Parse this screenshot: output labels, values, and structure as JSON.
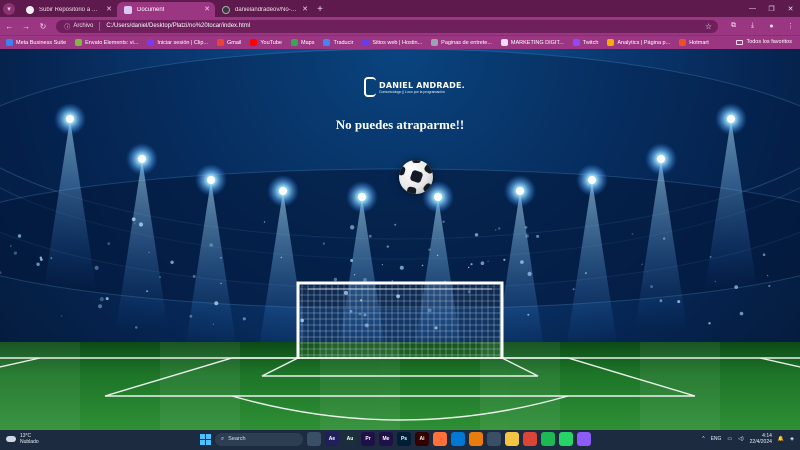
{
  "browser": {
    "tabs": [
      {
        "title": "Subir Repositorio a GitHub",
        "favicon": "github-icon",
        "active": false
      },
      {
        "title": "Document",
        "favicon": "document-icon",
        "active": true
      },
      {
        "title": "danielandradeov/No-me-pued...",
        "favicon": "github-icon",
        "active": false
      }
    ],
    "address": {
      "site_label": "Archivo",
      "url": "C:/Users/daniel/Desktop/Platzi/no%20tocar/index.html"
    },
    "bookmarks": [
      {
        "label": "Meta Business Suite",
        "color": "#3b82f6"
      },
      {
        "label": "Envato Elements: vi...",
        "color": "#82b541"
      },
      {
        "label": "Iniciar sesión | Clip...",
        "color": "#7c3aed"
      },
      {
        "label": "Gmail",
        "color": "#ea4335"
      },
      {
        "label": "YouTube",
        "color": "#ff0000"
      },
      {
        "label": "Maps",
        "color": "#34a853"
      },
      {
        "label": "Traducir",
        "color": "#4285f4"
      },
      {
        "label": "Sitios web | Hostin...",
        "color": "#673de6"
      },
      {
        "label": "Paginas de entrete...",
        "color": "#9ca3af"
      },
      {
        "label": "MARKETING DIGIT...",
        "color": "#f6dcef"
      },
      {
        "label": "Twitch",
        "color": "#9146ff"
      },
      {
        "label": "Analytics | Página p...",
        "color": "#f9ab00"
      },
      {
        "label": "Hotmart",
        "color": "#f04e23"
      }
    ],
    "all_bookmarks_label": "Todos los favoritos"
  },
  "page": {
    "logo_name": "DANIEL ANDRADE.",
    "logo_tagline": "Comunicólogo || Loco por la programación",
    "headline": "No puedes atraparme!!"
  },
  "taskbar": {
    "weather_temp": "13°C",
    "weather_desc": "Nublado",
    "search_placeholder": "Search",
    "apps": [
      {
        "name": "file-manager-icon",
        "label": "",
        "color": "#3a4f66"
      },
      {
        "name": "after-effects-icon",
        "label": "Ae",
        "color": "#1f1f5c"
      },
      {
        "name": "audition-icon",
        "label": "Au",
        "color": "#1a2f3a"
      },
      {
        "name": "premiere-icon",
        "label": "Pr",
        "color": "#1f1147"
      },
      {
        "name": "media-encoder-icon",
        "label": "Me",
        "color": "#1f1147"
      },
      {
        "name": "photoshop-icon",
        "label": "Ps",
        "color": "#001e36"
      },
      {
        "name": "illustrator-icon",
        "label": "Ai",
        "color": "#330000"
      },
      {
        "name": "firefox-icon",
        "label": "",
        "color": "#ff7139"
      },
      {
        "name": "vscode-icon",
        "label": "",
        "color": "#0078d4"
      },
      {
        "name": "blender-icon",
        "label": "",
        "color": "#e87d0d"
      },
      {
        "name": "calendar-icon",
        "label": "",
        "color": "#3a4f66"
      },
      {
        "name": "folder-icon",
        "label": "",
        "color": "#f4c542"
      },
      {
        "name": "chrome-icon",
        "label": "",
        "color": "#db4437"
      },
      {
        "name": "spotify-icon",
        "label": "",
        "color": "#1db954"
      },
      {
        "name": "whatsapp-icon",
        "label": "",
        "color": "#25d366"
      },
      {
        "name": "git-app-icon",
        "label": "",
        "color": "#8b5cf6"
      }
    ],
    "language": "ENG",
    "time": "4:14",
    "date": "22/4/2024"
  }
}
